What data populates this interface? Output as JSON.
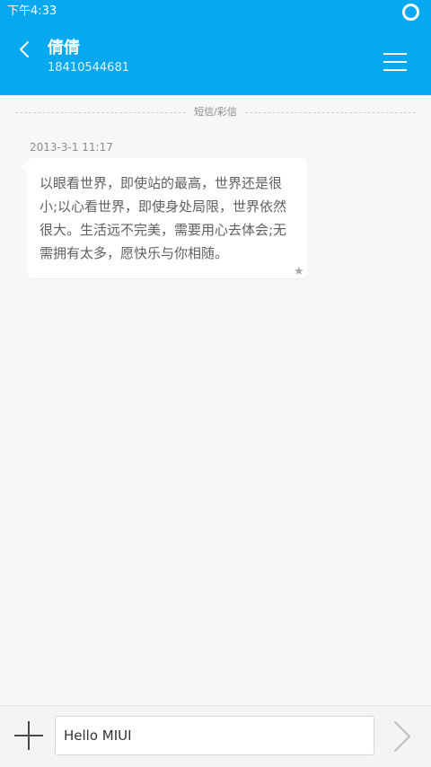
{
  "status_bar": {
    "time": "下午4:33"
  },
  "header": {
    "back_icon": "chevron-left-icon",
    "contact_name": "倩倩",
    "contact_phone": "18410544681",
    "menu_icon": "hamburger-menu-icon",
    "background_color": "#06a8ef"
  },
  "conversation": {
    "divider_label": "短信/彩信",
    "messages": [
      {
        "timestamp": "2013-3-1 11:17",
        "text": "以眼看世界，即使站的最高，世界还是很小;以心看世界，即使身处局限，世界依然很大。生活远不完美，需要用心去体会;无需拥有太多，愿快乐与你相随。",
        "starred": true,
        "star_icon": "star-icon"
      }
    ]
  },
  "composer": {
    "add_icon": "plus-icon",
    "input_value": "Hello MIUI",
    "send_icon": "chevron-right-icon"
  }
}
